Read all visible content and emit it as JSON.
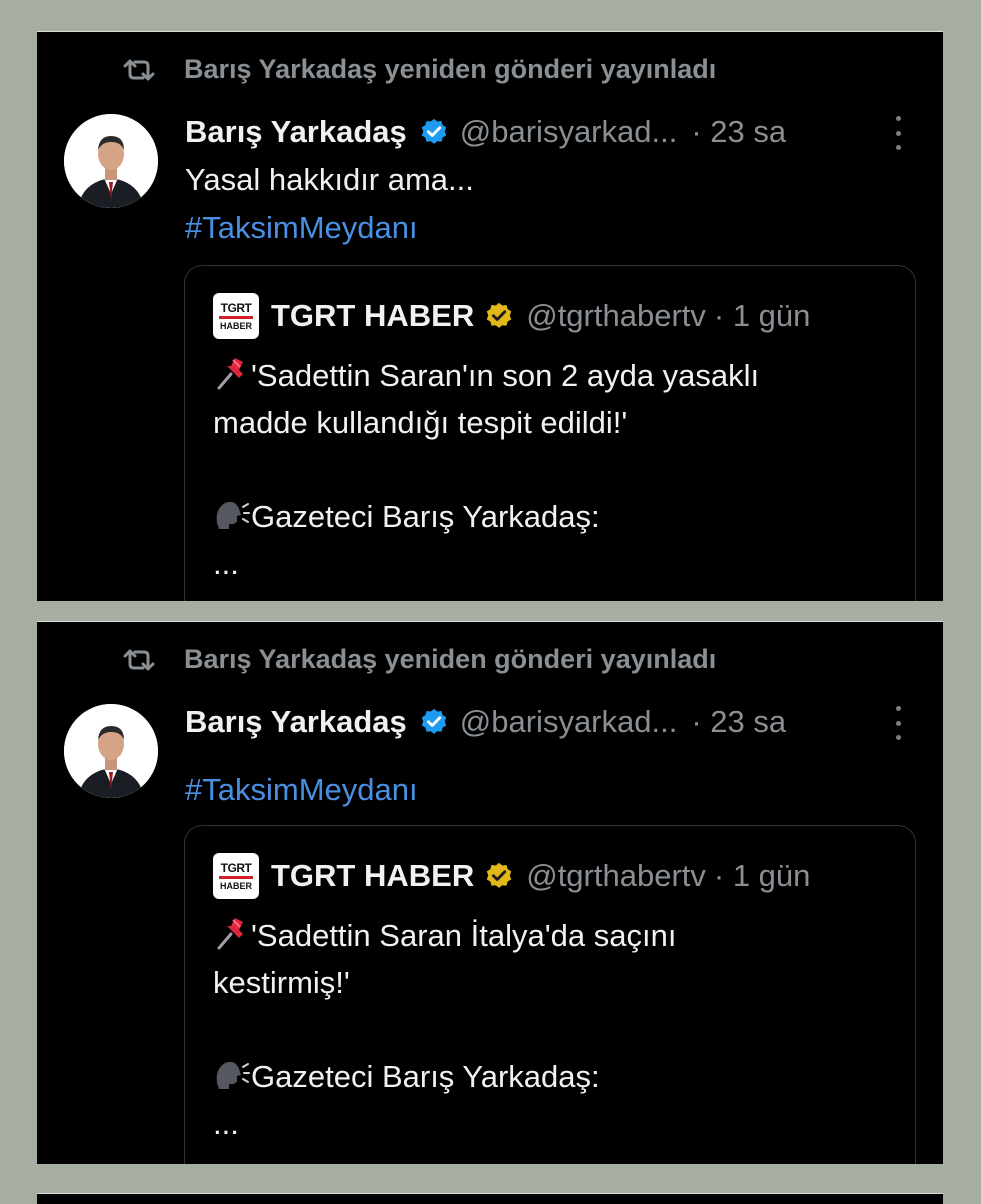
{
  "posts": [
    {
      "repost_text": "Barış Yarkadaş yeniden gönderi yayınladı",
      "author_name": "Barış Yarkadaş",
      "author_handle": "@barisyarkad...",
      "time": "· 23 sa",
      "text": "Yasal hakkıdır ama...",
      "hashtag": "#TaksimMeydanı",
      "quote": {
        "name": "TGRT HABER",
        "handle": "@tgrthabertv",
        "time": "· 1 gün",
        "logo_line1": "TGRT",
        "logo_line2": "HABER",
        "line1": "'Sadettin Saran'ın son 2 ayda yasaklı",
        "line2": "madde kullandığı tespit edildi!'",
        "line3": "Gazeteci Barış Yarkadaş:",
        "line4": "..."
      }
    },
    {
      "repost_text": "Barış Yarkadaş yeniden gönderi yayınladı",
      "author_name": "Barış Yarkadaş",
      "author_handle": "@barisyarkad...",
      "time": "· 23 sa",
      "text": "",
      "hashtag": "#TaksimMeydanı",
      "quote": {
        "name": "TGRT HABER",
        "handle": "@tgrthabertv",
        "time": "· 1 gün",
        "logo_line1": "TGRT",
        "logo_line2": "HABER",
        "line1": "'Sadettin Saran İtalya'da saçını",
        "line2": "kestirmiş!'",
        "line3": "Gazeteci Barış Yarkadaş:",
        "line4": "..."
      }
    }
  ],
  "icons": {
    "repost": "repost-icon",
    "verified_blue": "verified-badge-icon",
    "verified_gold": "gold-verified-badge-icon",
    "more": "more-options-icon",
    "pin": "pushpin-emoji-icon",
    "speaking_head": "speaking-head-emoji-icon"
  },
  "colors": {
    "background": "#a6aea2",
    "panel": "#000000",
    "text": "#f1f1f1",
    "muted": "#8a8f94",
    "link": "#4a90e2",
    "verified_blue": "#1d9bf0",
    "verified_gold": "#e2b719"
  }
}
